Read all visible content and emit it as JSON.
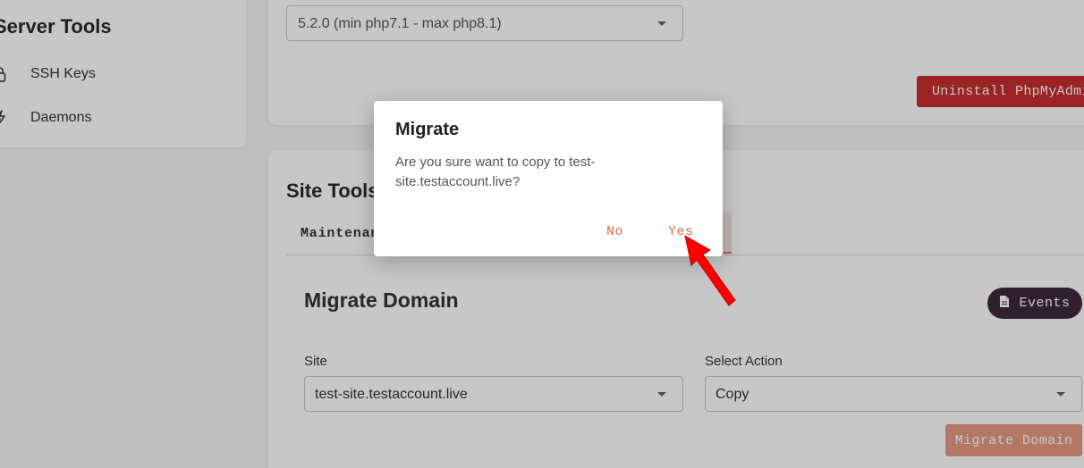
{
  "sidebar": {
    "title": "Server Tools",
    "items": [
      {
        "label": "SSH Keys",
        "icon": "lock-icon"
      },
      {
        "label": "Daemons",
        "icon": "bolt-icon"
      }
    ]
  },
  "top_card": {
    "version_select_value": "5.2.0 (min php7.1 - max php8.1)",
    "uninstall_label": "Uninstall PhpMyAdmin"
  },
  "site_tools": {
    "title": "Site Tools",
    "tab_label": "Maintenance",
    "section_title": "Migrate Domain",
    "events_label": "Events",
    "site_label": "Site",
    "site_value": "test-site.testaccount.live",
    "action_label": "Select Action",
    "action_value": "Copy",
    "migrate_label": "Migrate Domain"
  },
  "dialog": {
    "title": "Migrate",
    "message": "Are you sure want to copy to test-site.testaccount.live?",
    "no_label": "No",
    "yes_label": "Yes"
  },
  "colors": {
    "accent": "#e06a4a",
    "danger": "#c62e2e",
    "events_bg": "#3e2a3b",
    "pointer": "#ff0000"
  }
}
